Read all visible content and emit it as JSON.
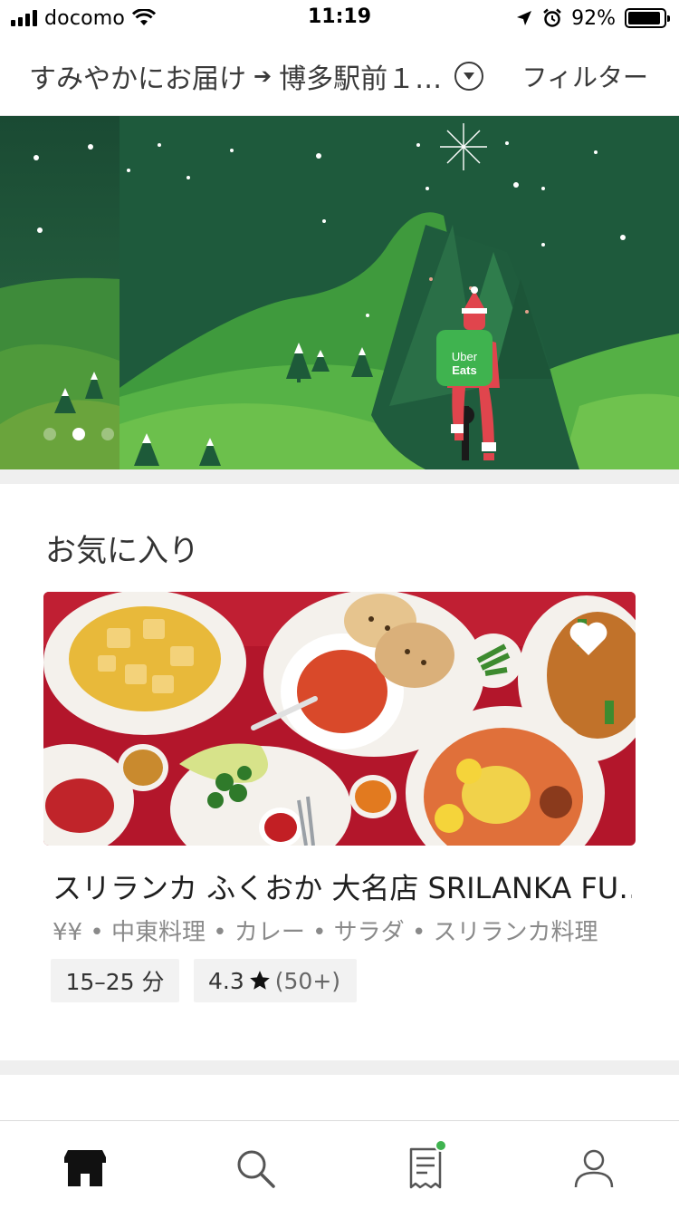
{
  "status_bar": {
    "carrier": "docomo",
    "time": "11:19",
    "battery": "92%",
    "battery_level": 0.92
  },
  "header": {
    "delivery_mode": "すみやかにお届け",
    "address": "博多駅前１…",
    "filter_label": "フィルター"
  },
  "banner": {
    "logo_line1": "Uber",
    "logo_line2": "Eats",
    "slide_count": 3,
    "active_slide": 2
  },
  "favorites": {
    "title": "お気に入り",
    "restaurant": {
      "name": "スリランカ ふくおか 大名店 SRILANKA FU…",
      "categories": "¥¥ • 中東料理 • カレー • サラダ • スリランカ料理",
      "delivery_time": "15–25 分",
      "rating": "4.3",
      "rating_count": "(50+)"
    }
  },
  "tabs": [
    {
      "icon": "home-icon",
      "active": true
    },
    {
      "icon": "search-icon",
      "active": false
    },
    {
      "icon": "orders-icon",
      "active": false
    },
    {
      "icon": "account-icon",
      "active": false
    }
  ],
  "colors": {
    "brand_green": "#3fb34f",
    "banner_dark": "#1e5a3c",
    "rider_red": "#e0454d"
  }
}
